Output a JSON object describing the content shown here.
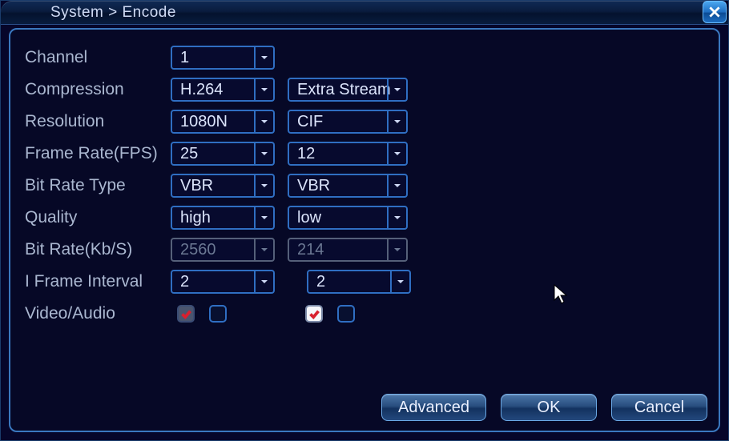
{
  "title": "System > Encode",
  "labels": {
    "channel": "Channel",
    "compression": "Compression",
    "resolution": "Resolution",
    "framerate": "Frame Rate(FPS)",
    "bitratetype": "Bit Rate Type",
    "quality": "Quality",
    "bitrate": "Bit Rate(Kb/S)",
    "iframe": "I Frame Interval",
    "videoaudio": "Video/Audio"
  },
  "main": {
    "channel": "1",
    "compression": "H.264",
    "resolution": "1080N",
    "framerate": "25",
    "bitratetype": "VBR",
    "quality": "high",
    "bitrate": "2560",
    "iframe": "2",
    "video_checked": true,
    "audio_checked": false
  },
  "extra": {
    "compression": "Extra Stream",
    "resolution": "CIF",
    "framerate": "12",
    "bitratetype": "VBR",
    "quality": "low",
    "bitrate": "214",
    "iframe": "2",
    "video_checked": true,
    "audio_checked": false
  },
  "buttons": {
    "advanced": "Advanced",
    "ok": "OK",
    "cancel": "Cancel"
  }
}
